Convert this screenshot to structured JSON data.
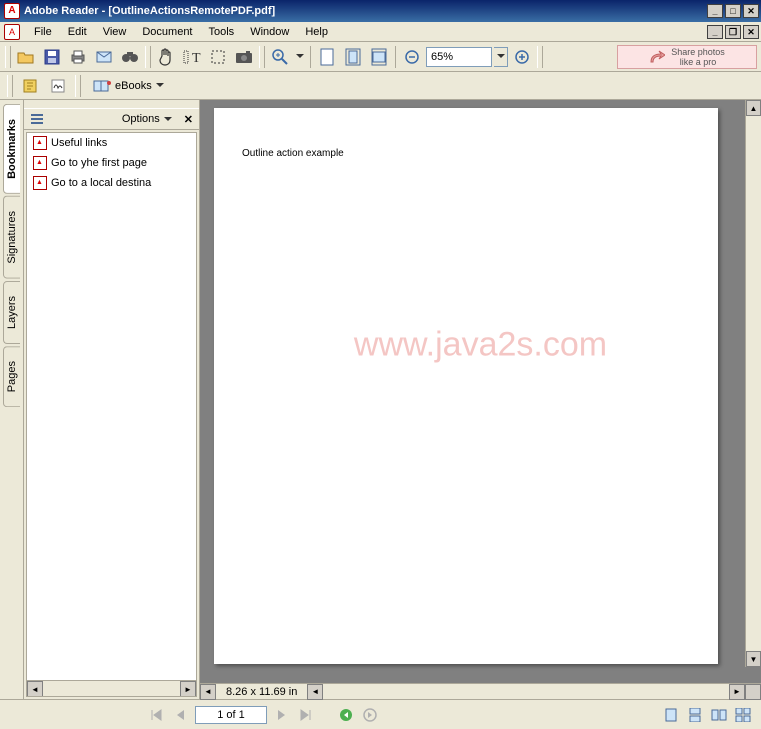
{
  "appTitle": "Adobe Reader - [OutlineActionsRemotePDF.pdf]",
  "menu": {
    "file": "File",
    "edit": "Edit",
    "view": "View",
    "document": "Document",
    "tools": "Tools",
    "window": "Window",
    "help": "Help"
  },
  "toolbar": {
    "zoom_value": "65%",
    "share_line1": "Share photos",
    "share_line2": "like a pro"
  },
  "toolbar2": {
    "ebooks_label": "eBooks"
  },
  "tabs": {
    "bookmarks": "Bookmarks",
    "signatures": "Signatures",
    "layers": "Layers",
    "pages": "Pages"
  },
  "bookmarks": {
    "options_label": "Options",
    "items": [
      {
        "label": "Useful links"
      },
      {
        "label": "Go to yhe first page"
      },
      {
        "label": "Go to a local destina"
      }
    ]
  },
  "document": {
    "body_text": "Outline action example",
    "watermark": "www.java2s.com",
    "page_size": "8.26 x 11.69 in"
  },
  "status": {
    "page_info": "1 of 1"
  }
}
